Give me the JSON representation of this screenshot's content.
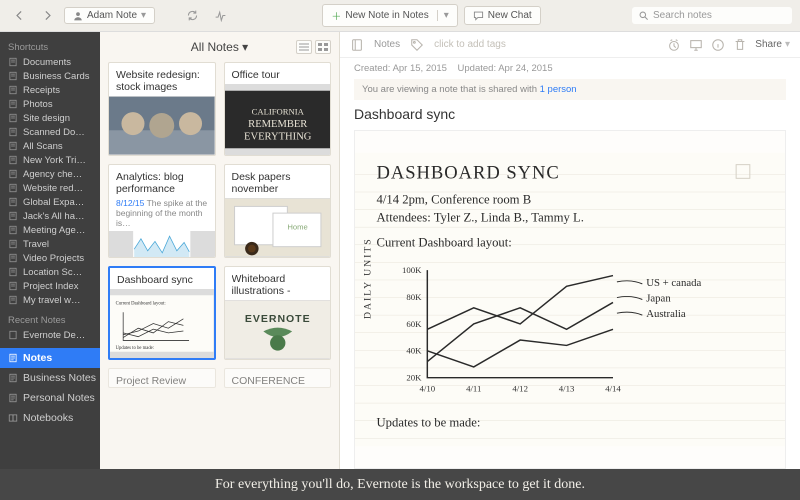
{
  "toolbar": {
    "account": "Adam Note",
    "new_note": "New Note in Notes",
    "new_chat": "New Chat",
    "search_placeholder": "Search notes"
  },
  "sidebar": {
    "shortcuts_header": "Shortcuts",
    "shortcuts": [
      "Documents",
      "Business Cards",
      "Receipts",
      "Photos",
      "Site design",
      "Scanned Do…",
      "All Scans",
      "New York Tri…",
      "Agency che…",
      "Website red…",
      "Global Expa…",
      "Jack's All ha…",
      "Meeting Age…",
      "Travel",
      "Video Projects",
      "Location Sc…",
      "Project Index",
      "My travel w…"
    ],
    "recent_header": "Recent Notes",
    "recent": [
      "Evernote De…"
    ],
    "main": [
      {
        "label": "Notes",
        "selected": true
      },
      {
        "label": "Business Notes",
        "selected": false
      },
      {
        "label": "Personal Notes",
        "selected": false
      },
      {
        "label": "Notebooks",
        "selected": false
      }
    ]
  },
  "notelist": {
    "title": "All Notes",
    "cards": [
      {
        "title": "Website redesign: stock images",
        "kind": "photo1"
      },
      {
        "title": "Office tour",
        "kind": "photo2"
      },
      {
        "title": "Analytics: blog performance Nove…",
        "kind": "chart",
        "date": "8/12/15",
        "snippet": "The spike at the beginning of the month is…"
      },
      {
        "title": "Desk papers november",
        "kind": "photo3"
      },
      {
        "title": "Dashboard sync",
        "kind": "sketch",
        "selected": true
      },
      {
        "title": "Whiteboard illustrations - Carlos…",
        "kind": "photo4"
      },
      {
        "title": "Project Review",
        "kind": "hidden"
      },
      {
        "title": "CONFERENCE",
        "kind": "hidden"
      }
    ]
  },
  "detail": {
    "breadcrumb": "Notes",
    "tags_placeholder": "click to add tags",
    "created_label": "Created:",
    "created": "Apr 15, 2015",
    "updated_label": "Updated:",
    "updated": "Apr 24, 2015",
    "shared_prefix": "You are viewing a note that is shared with ",
    "shared_link": "1 person",
    "share": "Share",
    "title": "Dashboard sync",
    "sketch": {
      "heading": "DASHBOARD SYNC",
      "line1": "4/14  2pm, Conference room B",
      "line2": "Attendees: Tyler Z., Linda B., Tammy L.",
      "line3": "Current Dashboard layout:",
      "ylabel": "DAILY UNITS",
      "yticks": [
        "100K",
        "80K",
        "60K",
        "40K",
        "20K"
      ],
      "xticks": [
        "4/10",
        "4/11",
        "4/12",
        "4/13",
        "4/14"
      ],
      "legend": [
        "US + canada",
        "Japan",
        "Australia"
      ],
      "footer": "Updates to be made:"
    }
  },
  "caption": "For everything you'll do, Evernote is the workspace to get it done."
}
